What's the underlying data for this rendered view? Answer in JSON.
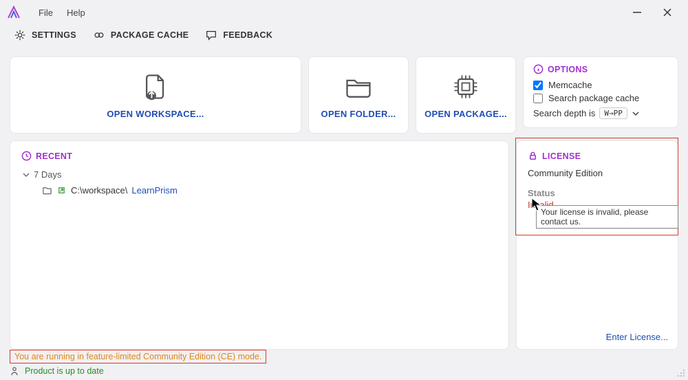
{
  "menu": {
    "file": "File",
    "help": "Help"
  },
  "toolbar": {
    "settings": "SETTINGS",
    "package_cache": "PACKAGE CACHE",
    "feedback": "FEEDBACK"
  },
  "actions": {
    "open_workspace": "OPEN WORKSPACE...",
    "open_folder": "OPEN FOLDER...",
    "open_package": "OPEN PACKAGE..."
  },
  "options": {
    "header": "OPTIONS",
    "memcache_label": "Memcache",
    "memcache_checked": true,
    "search_pkg_cache_label": "Search package cache",
    "search_pkg_cache_checked": false,
    "depth_prefix": "Search depth is",
    "depth_value": "W→PP"
  },
  "recent": {
    "header": "RECENT",
    "group": "7 Days",
    "item_path": "C:\\workspace\\",
    "item_link": "LearnPrism"
  },
  "license": {
    "header": "LICENSE",
    "edition": "Community Edition",
    "status_label": "Status",
    "status_value": "Invalid",
    "tooltip": "Your license is invalid, please contact us.",
    "enter": "Enter License..."
  },
  "status": {
    "ce_banner": "You are running in feature-limited Community Edition (CE) mode.",
    "update": "Product is up to date"
  },
  "colors": {
    "link": "#1f4db3",
    "accent_purple": "#a030d0",
    "error": "#c9302c",
    "warn": "#e0861c",
    "ok": "#2a8a2a"
  }
}
